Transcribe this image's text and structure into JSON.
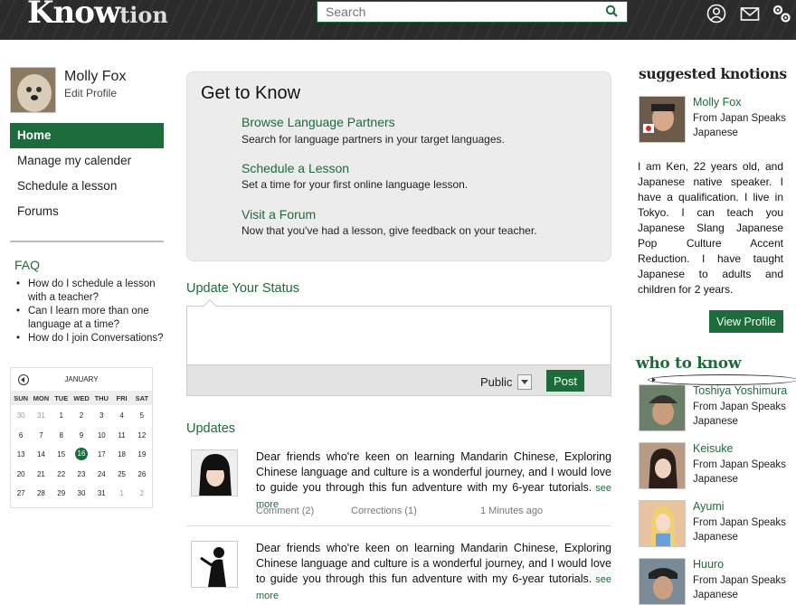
{
  "header": {
    "logo_big": "Know",
    "logo_small": "tion",
    "search_placeholder": "Search",
    "icons": [
      "search-icon",
      "profile-icon",
      "mail-icon",
      "settings-icon"
    ]
  },
  "profile": {
    "name": "Molly Fox",
    "edit_label": "Edit Profile"
  },
  "nav": [
    "Home",
    "Manage my calender",
    "Schedule a lesson",
    "Forums"
  ],
  "faq": {
    "title": "FAQ",
    "items": [
      "How do I schedule a lesson with a teacher?",
      "Can I learn more than one language at a time?",
      "How do I join Conversations?"
    ]
  },
  "calendar": {
    "month": "JANUARY",
    "days": [
      "SUN",
      "MON",
      "TUE",
      "WED",
      "THU",
      "FRI",
      "SAT"
    ],
    "weeks": [
      [
        "",
        "30",
        "31",
        "1",
        "2",
        "3",
        "4",
        "5"
      ],
      [
        "6",
        "7",
        "8",
        "9",
        "10",
        "11",
        "12"
      ],
      [
        "13",
        "14",
        "15",
        "16",
        "17",
        "18",
        "19"
      ],
      [
        "20",
        "21",
        "22",
        "23",
        "24",
        "25",
        "26"
      ],
      [
        "27",
        "28",
        "29",
        "30",
        "31",
        "1",
        "2"
      ]
    ],
    "today": "16"
  },
  "get_to_know": {
    "title": "Get to Know",
    "items": [
      {
        "link": "Browse Language Partners",
        "desc": "Search for language partners in your target languages."
      },
      {
        "link": "Schedule a Lesson",
        "desc": "Set a time for your first online language lesson."
      },
      {
        "link": "Visit a Forum",
        "desc": "Now that you've had a lesson, give feedback on your teacher."
      }
    ]
  },
  "status": {
    "title": "Update Your Status",
    "visibility": "Public",
    "post_label": "Post"
  },
  "updates": {
    "title": "Updates",
    "posts": [
      {
        "text": "Dear friends who're keen on learning Mandarin Chinese, Exploring Chinese language and culture is a wonderful journey, and I would love to guide you through this fun adventure with my 6-year tutorials.",
        "see_more": "see more",
        "comments": "Comment (2)",
        "corrections": "Corrections (1)",
        "time": "1 Minutes ago"
      },
      {
        "text": "Dear friends who're keen on learning Mandarin Chinese, Exploring Chinese language and culture is a wonderful journey, and I would love to guide you through this fun adventure with my 6-year tutorials.",
        "see_more": "see more"
      }
    ]
  },
  "suggested": {
    "title": "suggested knotions",
    "person": {
      "name": "Molly Fox",
      "from": "From Japan Speaks Japanese"
    },
    "bio": "I am Ken, 22 years old, and Japanese native speaker. I have a qualification. I live in Tokyo. I can teach you Japanese Slang Japanese Pop Culture Accent Reduction. I have taught Japanese to adults and children for 2 years.",
    "view_profile": "View Profile"
  },
  "who_to_know": {
    "title": "who to know",
    "people": [
      {
        "name": "Toshiya Yoshimura",
        "from": "From Japan Speaks Japanese"
      },
      {
        "name": "Keisuke",
        "from": "From Japan Speaks Japanese"
      },
      {
        "name": "Ayumi",
        "from": "From Japan Speaks Japanese"
      },
      {
        "name": "Huuro",
        "from": "From Japan Speaks Japanese"
      }
    ]
  },
  "colors": {
    "brand_green": "#1d6b3a",
    "topbar": "#2b2b2b"
  }
}
